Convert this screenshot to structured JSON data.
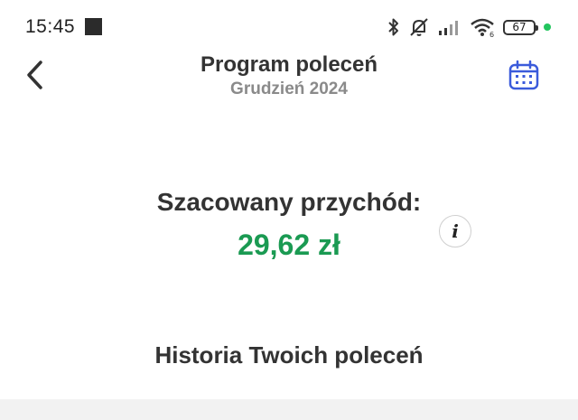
{
  "status_bar": {
    "time": "15:45",
    "battery_level": "67",
    "icons": [
      "bluetooth-icon",
      "muted-bell-icon",
      "signal-icon",
      "wifi-icon",
      "battery-icon",
      "notification-dot"
    ]
  },
  "header": {
    "title": "Program poleceń",
    "subtitle": "Grudzień 2024",
    "back_icon": "chevron-left-icon",
    "calendar_icon": "calendar-icon"
  },
  "revenue": {
    "label": "Szacowany przychód:",
    "value": "29,62 zł",
    "info_icon": "info-icon"
  },
  "history": {
    "title": "Historia Twoich poleceń"
  },
  "colors": {
    "accent_green": "#1a9a52",
    "calendar_blue": "#3b5bdb",
    "text_dark": "#333333",
    "text_muted": "#8a8a8a",
    "status_dot": "#22c55e"
  }
}
